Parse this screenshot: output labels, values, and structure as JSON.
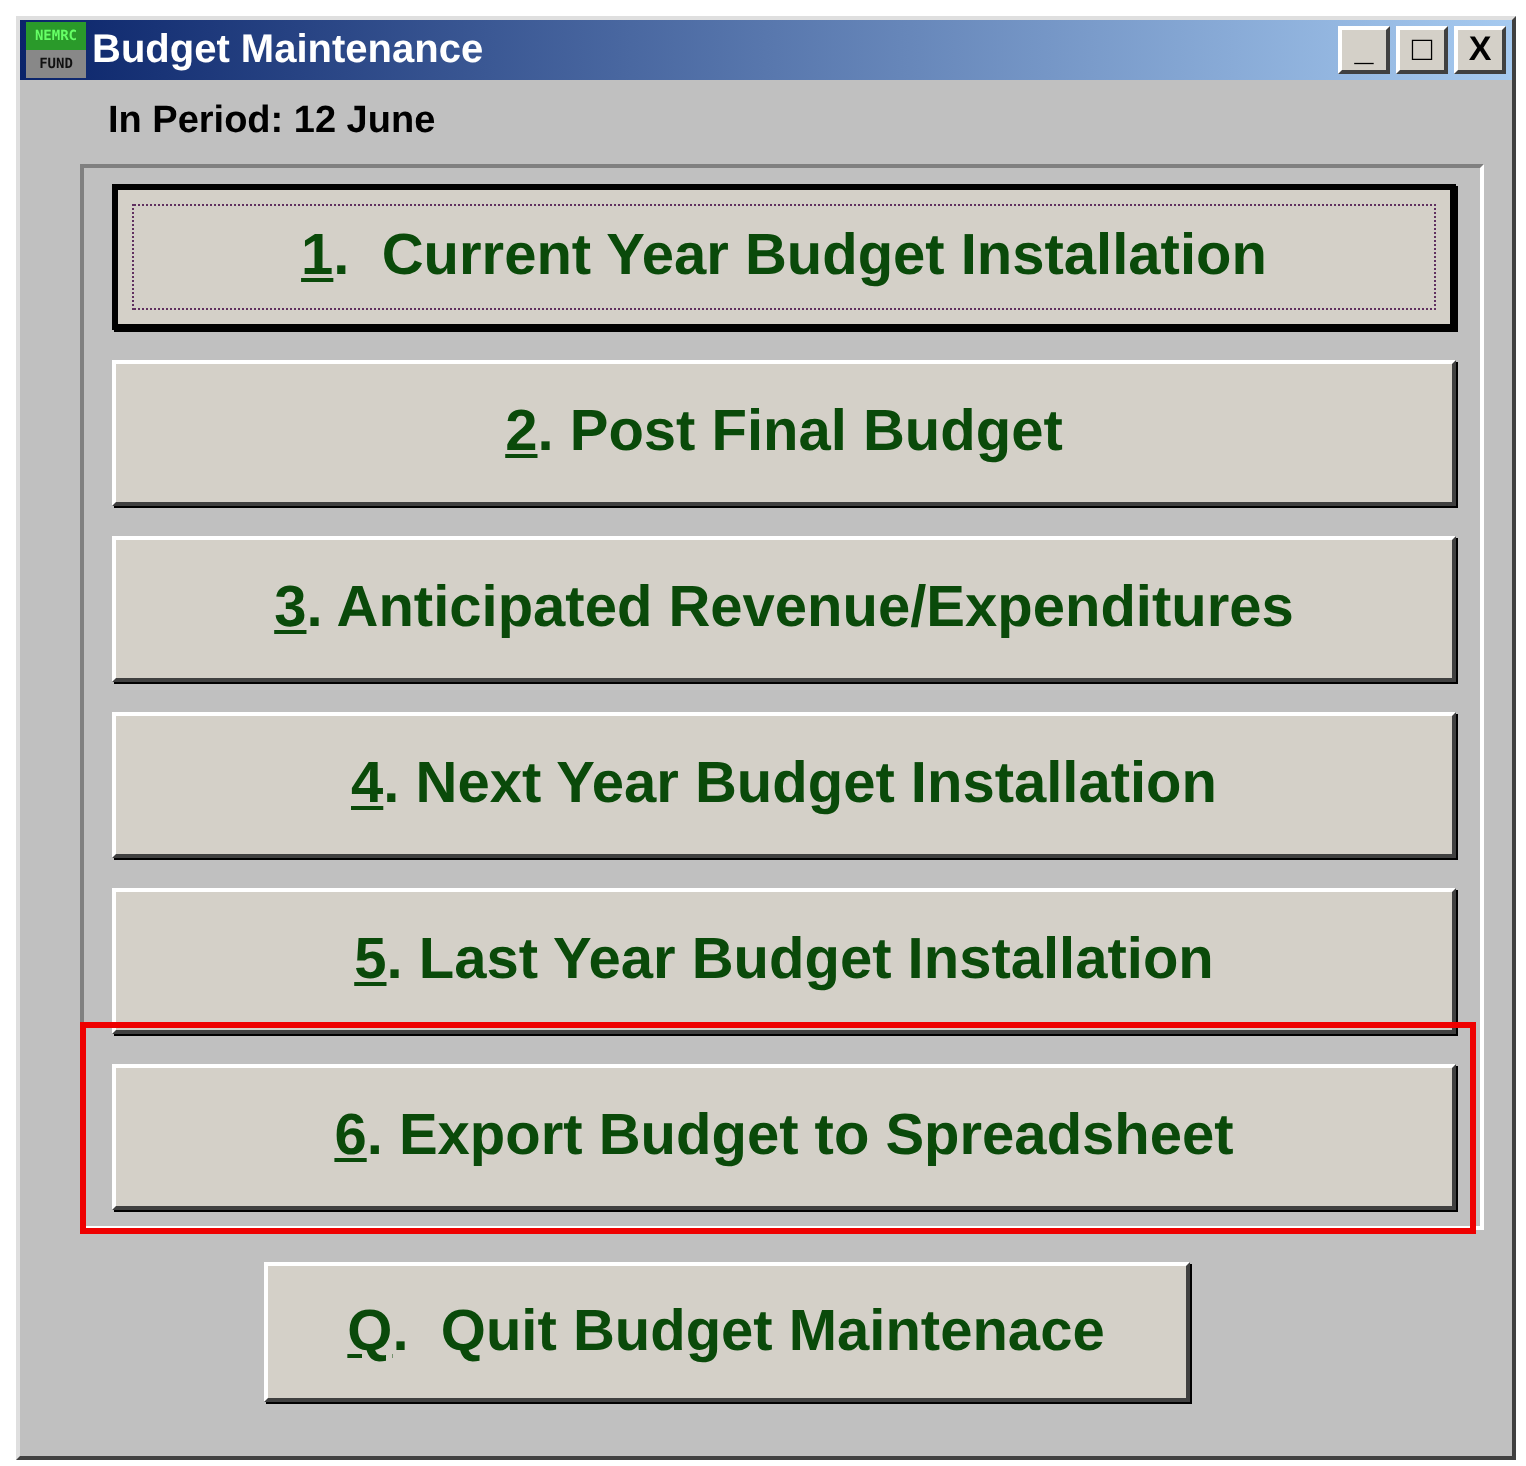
{
  "window": {
    "title": "Budget Maintenance",
    "app_icon": {
      "top": "NEMRC",
      "bottom": "FUND"
    },
    "controls": [
      "_",
      "□",
      "X"
    ]
  },
  "period_label": "In Period: 12 June",
  "menu_buttons": [
    {
      "key": "1",
      "label": ".  Current Year Budget Installation",
      "focused": true,
      "highlighted": false
    },
    {
      "key": "2",
      "label": ". Post Final Budget",
      "focused": false,
      "highlighted": false
    },
    {
      "key": "3",
      "label": ". Anticipated Revenue/Expenditures",
      "focused": false,
      "highlighted": false
    },
    {
      "key": "4",
      "label": ". Next Year Budget Installation",
      "focused": false,
      "highlighted": false
    },
    {
      "key": "5",
      "label": ". Last Year Budget Installation",
      "focused": false,
      "highlighted": false
    },
    {
      "key": "6",
      "label": ". Export Budget to Spreadsheet",
      "focused": false,
      "highlighted": true
    }
  ],
  "quit_button": {
    "key": "Q",
    "label": ".  Quit Budget Maintenace"
  }
}
